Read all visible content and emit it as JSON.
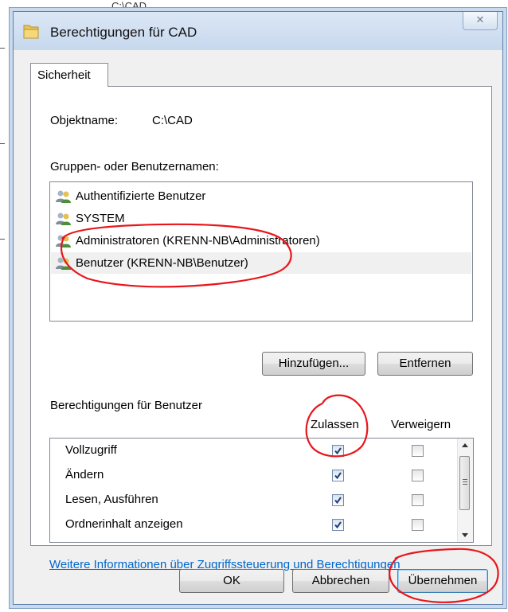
{
  "background": {
    "fragment_text": "C:\\CAD"
  },
  "window": {
    "title": "Berechtigungen für CAD",
    "close_symbol": "✕",
    "folder_icon": "folder-icon"
  },
  "tabs": [
    {
      "label": "Sicherheit",
      "active": true
    }
  ],
  "object": {
    "label": "Objektname:",
    "value": "C:\\CAD"
  },
  "groups": {
    "label": "Gruppen- oder Benutzernamen:",
    "items": [
      {
        "label": "Authentifizierte Benutzer",
        "icon": "user-group-icon",
        "selected": false
      },
      {
        "label": "SYSTEM",
        "icon": "user-group-icon",
        "selected": false
      },
      {
        "label": "Administratoren (KRENN-NB\\Administratoren)",
        "icon": "user-group-icon",
        "selected": false
      },
      {
        "label": "Benutzer (KRENN-NB\\Benutzer)",
        "icon": "user-group-icon",
        "selected": true
      }
    ]
  },
  "buttons": {
    "add": "Hinzufügen...",
    "remove": "Entfernen",
    "ok": "OK",
    "cancel": "Abbrechen",
    "apply": "Übernehmen"
  },
  "permissions": {
    "label": "Berechtigungen für Benutzer",
    "columns": {
      "allow": "Zulassen",
      "deny": "Verweigern"
    },
    "rows": [
      {
        "name": "Vollzugriff",
        "allow": true,
        "deny": false
      },
      {
        "name": "Ändern",
        "allow": true,
        "deny": false
      },
      {
        "name": "Lesen, Ausführen",
        "allow": true,
        "deny": false
      },
      {
        "name": "Ordnerinhalt anzeigen",
        "allow": true,
        "deny": false
      }
    ]
  },
  "link": "Weitere Informationen über Zugriffssteuerung und Berechtigungen",
  "colors": {
    "annotation": "#e8161b",
    "link": "#0066cc",
    "selection": "#f0f0f0"
  }
}
